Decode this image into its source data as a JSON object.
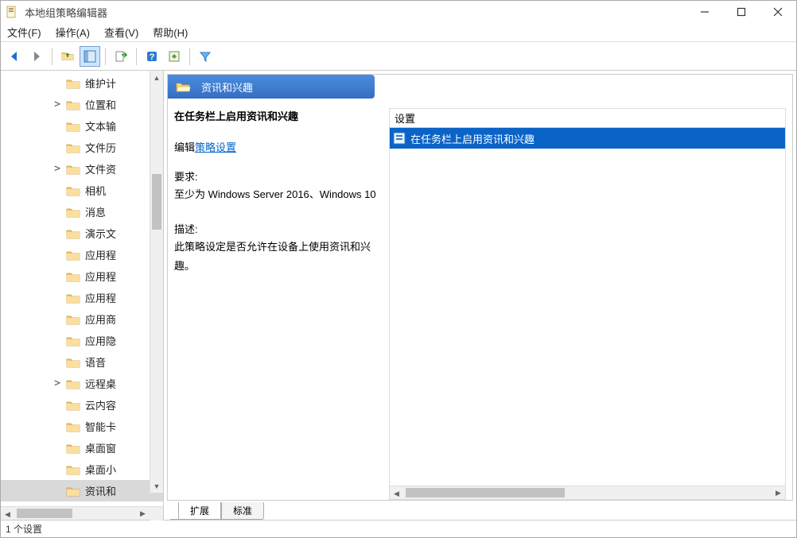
{
  "window": {
    "title": "本地组策略编辑器"
  },
  "menu": {
    "file": "文件(F)",
    "action": "操作(A)",
    "view": "查看(V)",
    "help": "帮助(H)"
  },
  "tree": {
    "items": [
      {
        "label": "维护计",
        "expandable": false
      },
      {
        "label": "位置和",
        "expandable": true
      },
      {
        "label": "文本输",
        "expandable": false
      },
      {
        "label": "文件历",
        "expandable": false
      },
      {
        "label": "文件资",
        "expandable": true
      },
      {
        "label": "相机",
        "expandable": false
      },
      {
        "label": "消息",
        "expandable": false
      },
      {
        "label": "演示文",
        "expandable": false
      },
      {
        "label": "应用程",
        "expandable": false
      },
      {
        "label": "应用程",
        "expandable": false
      },
      {
        "label": "应用程",
        "expandable": false
      },
      {
        "label": "应用商",
        "expandable": false
      },
      {
        "label": "应用隐",
        "expandable": false
      },
      {
        "label": "语音",
        "expandable": false
      },
      {
        "label": "远程桌",
        "expandable": true
      },
      {
        "label": "云内容",
        "expandable": false
      },
      {
        "label": "智能卡",
        "expandable": false
      },
      {
        "label": "桌面窗",
        "expandable": false
      },
      {
        "label": "桌面小",
        "expandable": false
      },
      {
        "label": "资讯和",
        "expandable": false,
        "selected": true
      }
    ]
  },
  "header": {
    "title": "资讯和兴趣"
  },
  "description": {
    "title": "在任务栏上启用资讯和兴趣",
    "edit_prefix": "编辑",
    "edit_link": "策略设置",
    "req_label": "要求:",
    "req_text": "至少为 Windows Server 2016、Windows 10",
    "desc_label": "描述:",
    "desc_text": "此策略设定是否允许在设备上使用资讯和兴趣。"
  },
  "settings_list": {
    "header": "设置",
    "items": [
      {
        "label": "在任务栏上启用资讯和兴趣",
        "selected": true
      }
    ]
  },
  "tabs": {
    "extended": "扩展",
    "standard": "标准"
  },
  "status": {
    "text": "1 个设置"
  }
}
